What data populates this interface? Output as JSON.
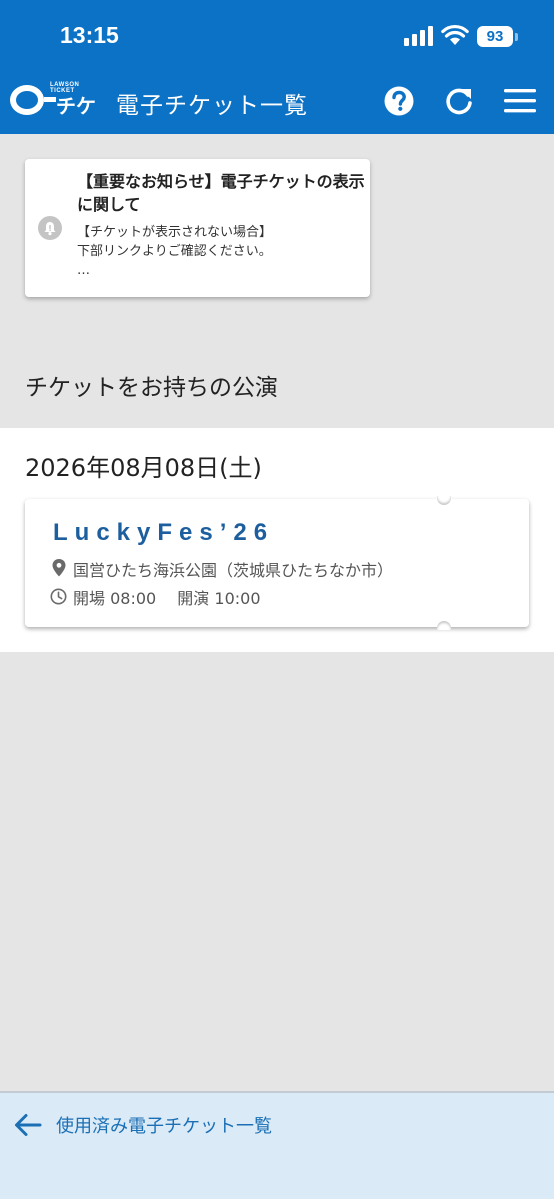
{
  "status_bar": {
    "time": "13:15",
    "battery": "93"
  },
  "header": {
    "logo_small": "LAWSON TICKET",
    "logo_text": "チケ",
    "title": "電子チケット一覧",
    "icons": [
      "help-icon",
      "refresh-icon",
      "menu-icon"
    ]
  },
  "notice": {
    "title": "【重要なお知らせ】電子チケットの表示に関して",
    "body_lines": [
      "【チケットが表示されない場合】",
      "下部リンクよりご確認ください。",
      "…"
    ]
  },
  "section_title": "チケットをお持ちの公演",
  "events": [
    {
      "date": "2026年08月08日(土)",
      "tickets": [
        {
          "name": "LuckyFes’26",
          "venue": "国営ひたち海浜公園（茨城県ひたちなか市）",
          "open": "開場 08:00",
          "start": "開演 10:00"
        }
      ]
    }
  ],
  "footer": {
    "label": "使用済み電子チケット一覧"
  },
  "colors": {
    "brand_blue": "#0c72c6",
    "ticket_title": "#1d5f9e",
    "footer_bg": "#dbeaf7"
  }
}
